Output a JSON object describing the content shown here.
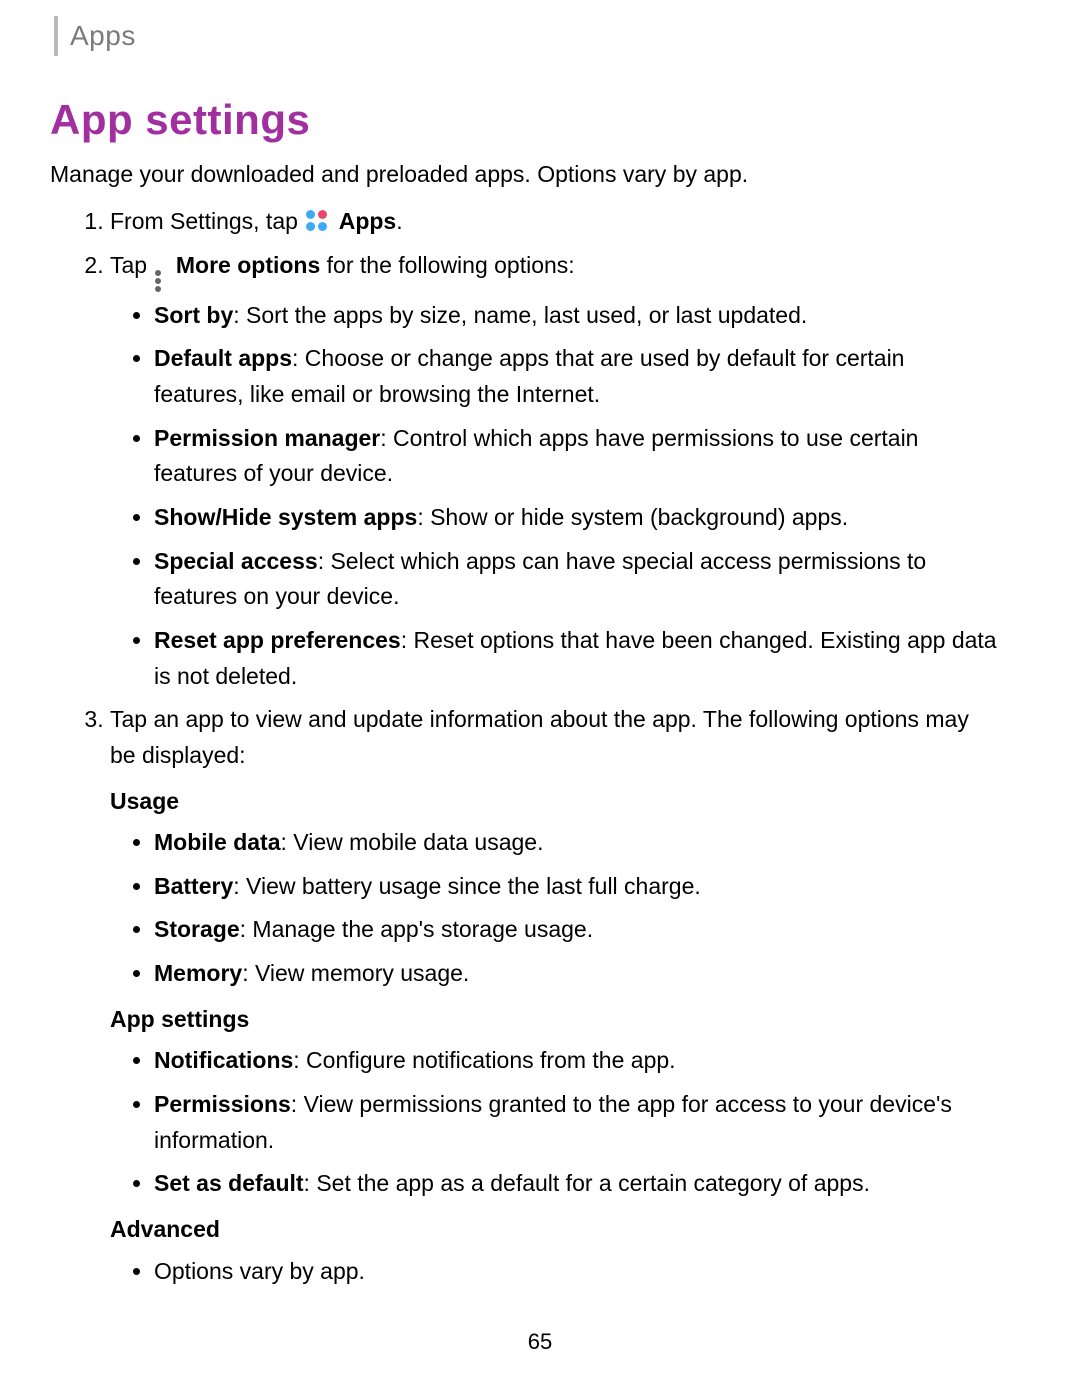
{
  "header": "Apps",
  "title": "App settings",
  "intro": "Manage your downloaded and preloaded apps. Options vary by app.",
  "step1": {
    "pre": "From Settings, tap",
    "post": "Apps",
    "tail": "."
  },
  "step2": {
    "pre": "Tap",
    "mid": "More options",
    "tail": " for the following options:"
  },
  "moreOptions": {
    "sortBy": {
      "t": "Sort by",
      "d": ": Sort the apps by size, name, last used, or last updated."
    },
    "defaultApps": {
      "t": "Default apps",
      "d": ": Choose or change apps that are used by default for certain features, like email or browsing the Internet."
    },
    "permissionManager": {
      "t": "Permission manager",
      "d": ": Control which apps have permissions to use certain features of your device."
    },
    "showHide": {
      "t": "Show/Hide system apps",
      "d": ": Show or hide system (background) apps."
    },
    "specialAccess": {
      "t": "Special access",
      "d": ": Select which apps can have special access permissions to features on your device."
    },
    "resetPrefs": {
      "t": "Reset app preferences",
      "d": ": Reset options that have been changed. Existing app data is not deleted."
    }
  },
  "step3": "Tap an app to view and update information about the app. The following options may be displayed:",
  "usage": {
    "heading": "Usage",
    "mobileData": {
      "t": "Mobile data",
      "d": ": View mobile data usage."
    },
    "battery": {
      "t": "Battery",
      "d": ": View battery usage since the last full charge."
    },
    "storage": {
      "t": "Storage",
      "d": ": Manage the app's storage usage."
    },
    "memory": {
      "t": "Memory",
      "d": ": View memory usage."
    }
  },
  "appSettings": {
    "heading": "App settings",
    "notifications": {
      "t": "Notifications",
      "d": ": Configure notifications from the app."
    },
    "permissions": {
      "t": "Permissions",
      "d": ": View permissions granted to the app for access to your device's information."
    },
    "setDefault": {
      "t": "Set as default",
      "d": ": Set the app as a default for a certain category of apps."
    }
  },
  "advanced": {
    "heading": "Advanced",
    "item": "Options vary by app."
  },
  "pageNumber": "65"
}
